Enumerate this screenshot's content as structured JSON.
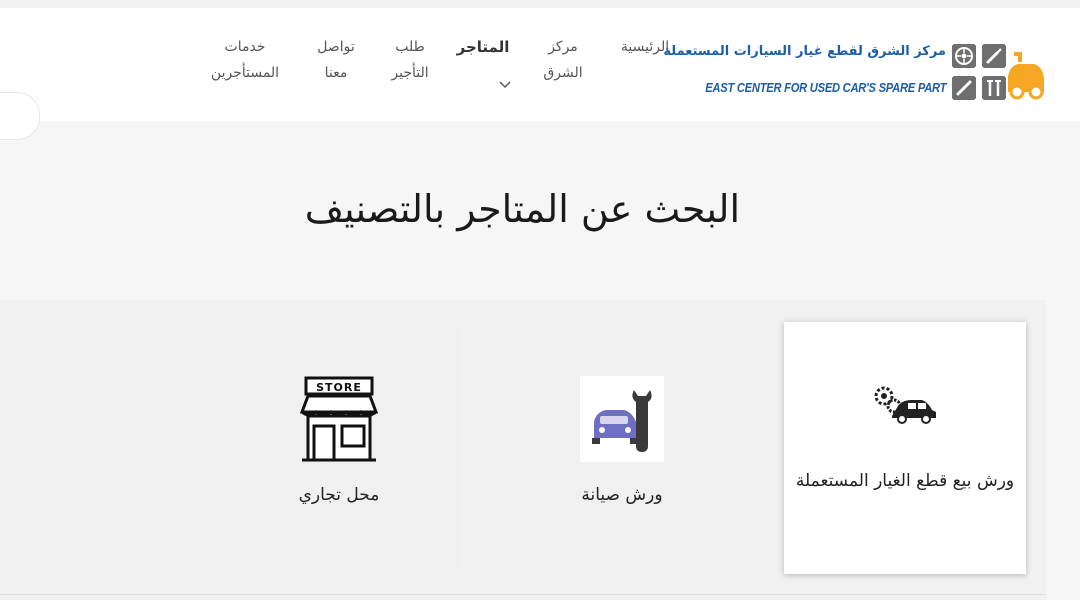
{
  "header": {
    "logo": {
      "arabic_name": "مركز الشرق لقطع غيار السيارات المستعملة",
      "english_name": "EAST CENTER FOR USED CAR'S SPARE PART"
    },
    "nav": [
      {
        "label": "الرئيسية"
      },
      {
        "label": "مركز الشرق"
      },
      {
        "label": "المتاجر",
        "has_dropdown": true
      },
      {
        "label": "طلب التأجير"
      },
      {
        "label": "تواصل معنا"
      },
      {
        "label": "خدمات المستأجرين"
      }
    ]
  },
  "page_title": "البحث عن المتاجر بالتصنيف",
  "categories": [
    {
      "label": "ورش بيع قطع الغيار المستعملة",
      "icon": "car-gear-icon",
      "active": true
    },
    {
      "label": "ورش صيانة",
      "icon": "car-wrench-icon",
      "active": false
    },
    {
      "label": "محل تجاري",
      "icon": "store-icon",
      "active": false,
      "icon_text": "STORE"
    }
  ],
  "colors": {
    "logo_blue": "#1d5ea8",
    "logo_orange": "#f5a623",
    "icon_purple": "#6f6fc2"
  }
}
